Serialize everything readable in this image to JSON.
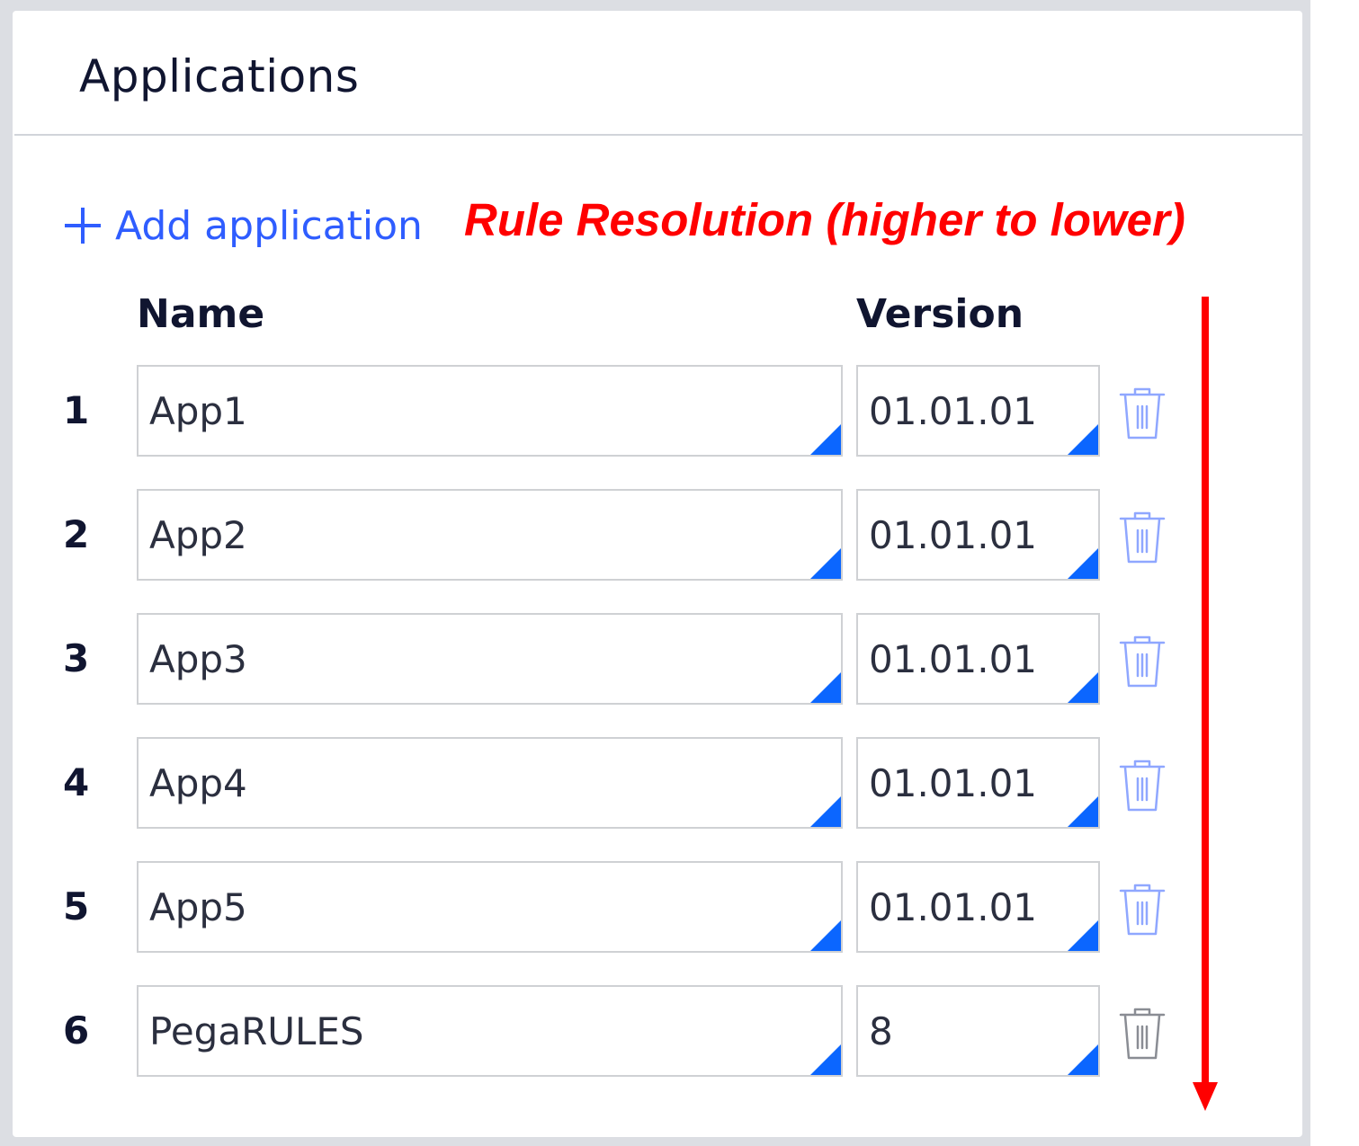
{
  "panel": {
    "title": "Applications",
    "add_button_label": "Add application",
    "annotation": "Rule Resolution (higher to lower)",
    "columns": {
      "name": "Name",
      "version": "Version"
    },
    "rows": [
      {
        "index": "1",
        "name": "App1",
        "version": "01.01.01",
        "delete_enabled": true
      },
      {
        "index": "2",
        "name": "App2",
        "version": "01.01.01",
        "delete_enabled": true
      },
      {
        "index": "3",
        "name": "App3",
        "version": "01.01.01",
        "delete_enabled": true
      },
      {
        "index": "4",
        "name": "App4",
        "version": "01.01.01",
        "delete_enabled": true
      },
      {
        "index": "5",
        "name": "App5",
        "version": "01.01.01",
        "delete_enabled": true
      },
      {
        "index": "6",
        "name": "PegaRULES",
        "version": "8",
        "delete_enabled": false
      }
    ]
  },
  "colors": {
    "accent": "#2f5dff",
    "field_corner": "#0b66ff",
    "annotation": "#ff0000",
    "trash_enabled": "#8fa7ff",
    "trash_disabled": "#8a8d94"
  },
  "icons": {
    "add": "plus-icon",
    "delete": "trash-icon",
    "annotation_arrow": "arrow-down-icon"
  }
}
